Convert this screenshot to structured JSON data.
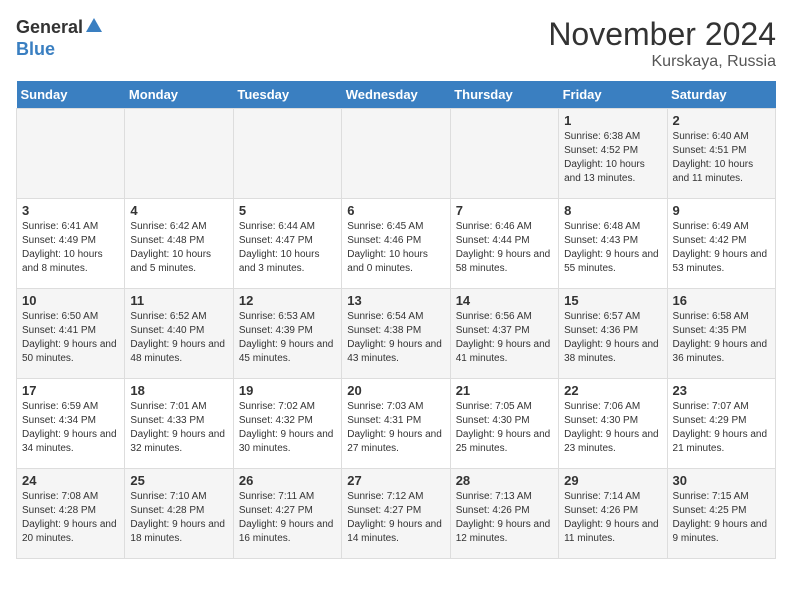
{
  "logo": {
    "general": "General",
    "blue": "Blue"
  },
  "title": {
    "month": "November 2024",
    "location": "Kurskaya, Russia"
  },
  "headers": [
    "Sunday",
    "Monday",
    "Tuesday",
    "Wednesday",
    "Thursday",
    "Friday",
    "Saturday"
  ],
  "weeks": [
    [
      {
        "day": "",
        "info": ""
      },
      {
        "day": "",
        "info": ""
      },
      {
        "day": "",
        "info": ""
      },
      {
        "day": "",
        "info": ""
      },
      {
        "day": "",
        "info": ""
      },
      {
        "day": "1",
        "info": "Sunrise: 6:38 AM\nSunset: 4:52 PM\nDaylight: 10 hours and 13 minutes."
      },
      {
        "day": "2",
        "info": "Sunrise: 6:40 AM\nSunset: 4:51 PM\nDaylight: 10 hours and 11 minutes."
      }
    ],
    [
      {
        "day": "3",
        "info": "Sunrise: 6:41 AM\nSunset: 4:49 PM\nDaylight: 10 hours and 8 minutes."
      },
      {
        "day": "4",
        "info": "Sunrise: 6:42 AM\nSunset: 4:48 PM\nDaylight: 10 hours and 5 minutes."
      },
      {
        "day": "5",
        "info": "Sunrise: 6:44 AM\nSunset: 4:47 PM\nDaylight: 10 hours and 3 minutes."
      },
      {
        "day": "6",
        "info": "Sunrise: 6:45 AM\nSunset: 4:46 PM\nDaylight: 10 hours and 0 minutes."
      },
      {
        "day": "7",
        "info": "Sunrise: 6:46 AM\nSunset: 4:44 PM\nDaylight: 9 hours and 58 minutes."
      },
      {
        "day": "8",
        "info": "Sunrise: 6:48 AM\nSunset: 4:43 PM\nDaylight: 9 hours and 55 minutes."
      },
      {
        "day": "9",
        "info": "Sunrise: 6:49 AM\nSunset: 4:42 PM\nDaylight: 9 hours and 53 minutes."
      }
    ],
    [
      {
        "day": "10",
        "info": "Sunrise: 6:50 AM\nSunset: 4:41 PM\nDaylight: 9 hours and 50 minutes."
      },
      {
        "day": "11",
        "info": "Sunrise: 6:52 AM\nSunset: 4:40 PM\nDaylight: 9 hours and 48 minutes."
      },
      {
        "day": "12",
        "info": "Sunrise: 6:53 AM\nSunset: 4:39 PM\nDaylight: 9 hours and 45 minutes."
      },
      {
        "day": "13",
        "info": "Sunrise: 6:54 AM\nSunset: 4:38 PM\nDaylight: 9 hours and 43 minutes."
      },
      {
        "day": "14",
        "info": "Sunrise: 6:56 AM\nSunset: 4:37 PM\nDaylight: 9 hours and 41 minutes."
      },
      {
        "day": "15",
        "info": "Sunrise: 6:57 AM\nSunset: 4:36 PM\nDaylight: 9 hours and 38 minutes."
      },
      {
        "day": "16",
        "info": "Sunrise: 6:58 AM\nSunset: 4:35 PM\nDaylight: 9 hours and 36 minutes."
      }
    ],
    [
      {
        "day": "17",
        "info": "Sunrise: 6:59 AM\nSunset: 4:34 PM\nDaylight: 9 hours and 34 minutes."
      },
      {
        "day": "18",
        "info": "Sunrise: 7:01 AM\nSunset: 4:33 PM\nDaylight: 9 hours and 32 minutes."
      },
      {
        "day": "19",
        "info": "Sunrise: 7:02 AM\nSunset: 4:32 PM\nDaylight: 9 hours and 30 minutes."
      },
      {
        "day": "20",
        "info": "Sunrise: 7:03 AM\nSunset: 4:31 PM\nDaylight: 9 hours and 27 minutes."
      },
      {
        "day": "21",
        "info": "Sunrise: 7:05 AM\nSunset: 4:30 PM\nDaylight: 9 hours and 25 minutes."
      },
      {
        "day": "22",
        "info": "Sunrise: 7:06 AM\nSunset: 4:30 PM\nDaylight: 9 hours and 23 minutes."
      },
      {
        "day": "23",
        "info": "Sunrise: 7:07 AM\nSunset: 4:29 PM\nDaylight: 9 hours and 21 minutes."
      }
    ],
    [
      {
        "day": "24",
        "info": "Sunrise: 7:08 AM\nSunset: 4:28 PM\nDaylight: 9 hours and 20 minutes."
      },
      {
        "day": "25",
        "info": "Sunrise: 7:10 AM\nSunset: 4:28 PM\nDaylight: 9 hours and 18 minutes."
      },
      {
        "day": "26",
        "info": "Sunrise: 7:11 AM\nSunset: 4:27 PM\nDaylight: 9 hours and 16 minutes."
      },
      {
        "day": "27",
        "info": "Sunrise: 7:12 AM\nSunset: 4:27 PM\nDaylight: 9 hours and 14 minutes."
      },
      {
        "day": "28",
        "info": "Sunrise: 7:13 AM\nSunset: 4:26 PM\nDaylight: 9 hours and 12 minutes."
      },
      {
        "day": "29",
        "info": "Sunrise: 7:14 AM\nSunset: 4:26 PM\nDaylight: 9 hours and 11 minutes."
      },
      {
        "day": "30",
        "info": "Sunrise: 7:15 AM\nSunset: 4:25 PM\nDaylight: 9 hours and 9 minutes."
      }
    ]
  ]
}
